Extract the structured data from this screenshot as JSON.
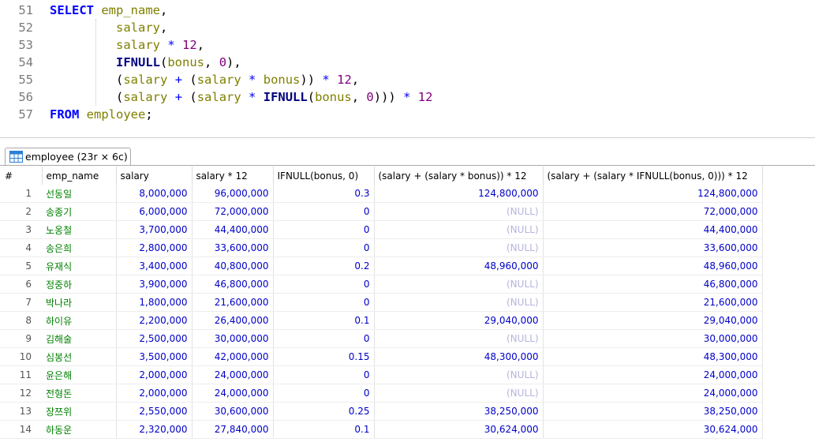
{
  "editor": {
    "lines": [
      {
        "num": "51",
        "tokens": [
          [
            "k",
            "SELECT"
          ],
          [
            "p",
            " "
          ],
          [
            "id",
            "emp_name"
          ],
          [
            "p",
            ","
          ]
        ]
      },
      {
        "num": "52",
        "tokens": [
          [
            "p",
            "         "
          ],
          [
            "id",
            "salary"
          ],
          [
            "p",
            ","
          ]
        ]
      },
      {
        "num": "53",
        "tokens": [
          [
            "p",
            "         "
          ],
          [
            "id",
            "salary"
          ],
          [
            "p",
            " "
          ],
          [
            "o",
            "*"
          ],
          [
            "p",
            " "
          ],
          [
            "n",
            "12"
          ],
          [
            "p",
            ","
          ]
        ]
      },
      {
        "num": "54",
        "tokens": [
          [
            "p",
            "         "
          ],
          [
            "f",
            "IFNULL"
          ],
          [
            "p",
            "("
          ],
          [
            "id",
            "bonus"
          ],
          [
            "p",
            ", "
          ],
          [
            "n",
            "0"
          ],
          [
            "p",
            "),"
          ]
        ]
      },
      {
        "num": "55",
        "tokens": [
          [
            "p",
            "         "
          ],
          [
            "p",
            "("
          ],
          [
            "id",
            "salary"
          ],
          [
            "p",
            " "
          ],
          [
            "o",
            "+"
          ],
          [
            "p",
            " ("
          ],
          [
            "id",
            "salary"
          ],
          [
            "p",
            " "
          ],
          [
            "o",
            "*"
          ],
          [
            "p",
            " "
          ],
          [
            "id",
            "bonus"
          ],
          [
            "p",
            "))"
          ],
          [
            "p",
            " "
          ],
          [
            "o",
            "*"
          ],
          [
            "p",
            " "
          ],
          [
            "n",
            "12"
          ],
          [
            "p",
            ","
          ]
        ]
      },
      {
        "num": "56",
        "tokens": [
          [
            "p",
            "         "
          ],
          [
            "p",
            "("
          ],
          [
            "id",
            "salary"
          ],
          [
            "p",
            " "
          ],
          [
            "o",
            "+"
          ],
          [
            "p",
            " ("
          ],
          [
            "id",
            "salary"
          ],
          [
            "p",
            " "
          ],
          [
            "o",
            "*"
          ],
          [
            "p",
            " "
          ],
          [
            "f",
            "IFNULL"
          ],
          [
            "p",
            "("
          ],
          [
            "id",
            "bonus"
          ],
          [
            "p",
            ", "
          ],
          [
            "n",
            "0"
          ],
          [
            "p",
            ")))"
          ],
          [
            "p",
            " "
          ],
          [
            "o",
            "*"
          ],
          [
            "p",
            " "
          ],
          [
            "n",
            "12"
          ]
        ]
      },
      {
        "num": "57",
        "tokens": [
          [
            "k",
            "FROM"
          ],
          [
            "p",
            " "
          ],
          [
            "id",
            "employee"
          ],
          [
            "p",
            ";"
          ]
        ]
      }
    ]
  },
  "result_tab": {
    "label": "employee (23r × 6c)",
    "icon": "table-grid-icon"
  },
  "grid": {
    "columns": [
      "#",
      "emp_name",
      "salary",
      "salary * 12",
      "IFNULL(bonus, 0)",
      "(salary + (salary * bonus)) * 12",
      "(salary + (salary * IFNULL(bonus, 0))) * 12"
    ],
    "rows": [
      [
        "1",
        "선동일",
        "8,000,000",
        "96,000,000",
        "0.3",
        "124,800,000",
        "124,800,000"
      ],
      [
        "2",
        "송종기",
        "6,000,000",
        "72,000,000",
        "0",
        "(NULL)",
        "72,000,000"
      ],
      [
        "3",
        "노옹철",
        "3,700,000",
        "44,400,000",
        "0",
        "(NULL)",
        "44,400,000"
      ],
      [
        "4",
        "송은희",
        "2,800,000",
        "33,600,000",
        "0",
        "(NULL)",
        "33,600,000"
      ],
      [
        "5",
        "유재식",
        "3,400,000",
        "40,800,000",
        "0.2",
        "48,960,000",
        "48,960,000"
      ],
      [
        "6",
        "정중하",
        "3,900,000",
        "46,800,000",
        "0",
        "(NULL)",
        "46,800,000"
      ],
      [
        "7",
        "박나라",
        "1,800,000",
        "21,600,000",
        "0",
        "(NULL)",
        "21,600,000"
      ],
      [
        "8",
        "하이유",
        "2,200,000",
        "26,400,000",
        "0.1",
        "29,040,000",
        "29,040,000"
      ],
      [
        "9",
        "김해술",
        "2,500,000",
        "30,000,000",
        "0",
        "(NULL)",
        "30,000,000"
      ],
      [
        "10",
        "심봉선",
        "3,500,000",
        "42,000,000",
        "0.15",
        "48,300,000",
        "48,300,000"
      ],
      [
        "11",
        "윤은해",
        "2,000,000",
        "24,000,000",
        "0",
        "(NULL)",
        "24,000,000"
      ],
      [
        "12",
        "전형돈",
        "2,000,000",
        "24,000,000",
        "0",
        "(NULL)",
        "24,000,000"
      ],
      [
        "13",
        "장쯔위",
        "2,550,000",
        "30,600,000",
        "0.25",
        "38,250,000",
        "38,250,000"
      ],
      [
        "14",
        "하동운",
        "2,320,000",
        "27,840,000",
        "0.1",
        "30,624,000",
        "30,624,000"
      ]
    ]
  },
  "colors": {
    "keyword": "#0000ff",
    "identifier": "#7f7f00",
    "number": "#800080",
    "function": "#000080",
    "cell_number": "#0000c8",
    "cell_text": "#008000",
    "null": "#b4b4dc"
  }
}
